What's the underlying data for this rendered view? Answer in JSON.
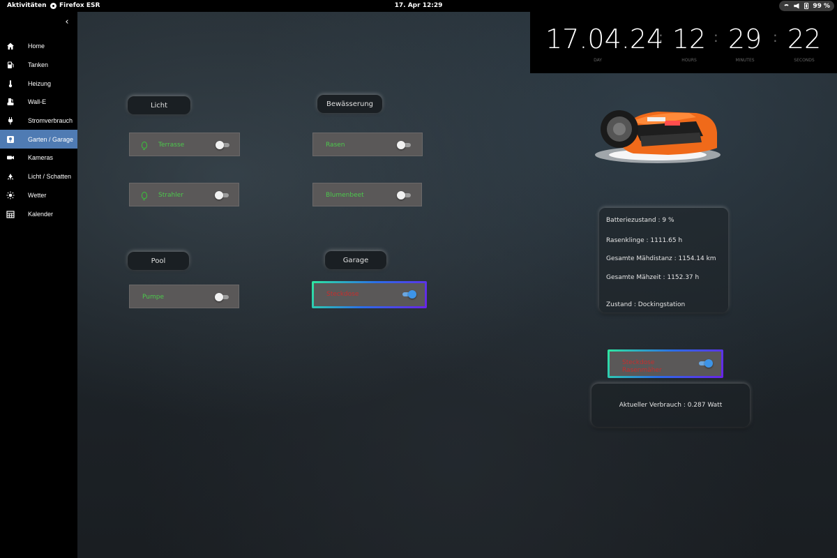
{
  "topbar": {
    "activities": "Aktivitäten",
    "app_name": "Firefox ESR",
    "clock": "17. Apr  12:29",
    "battery": "99 %"
  },
  "sidebar": {
    "items": [
      {
        "label": "Home",
        "icon": "home-icon"
      },
      {
        "label": "Tanken",
        "icon": "fuel-icon"
      },
      {
        "label": "Heizung",
        "icon": "thermometer-icon"
      },
      {
        "label": "Wall-E",
        "icon": "ev-charger-icon"
      },
      {
        "label": "Stromverbrauch",
        "icon": "power-plug-icon"
      },
      {
        "label": "Garten / Garage",
        "icon": "garden-icon",
        "active": true
      },
      {
        "label": "Kameras",
        "icon": "camera-icon"
      },
      {
        "label": "Licht / Schatten",
        "icon": "light-icon"
      },
      {
        "label": "Wetter",
        "icon": "sun-icon"
      },
      {
        "label": "Kalender",
        "icon": "calendar-icon"
      }
    ]
  },
  "clock": {
    "date": "17.04.24",
    "date_label": "DAY",
    "hours": "12",
    "hours_label": "HOURS",
    "minutes": "29",
    "minutes_label": "MINUTES",
    "seconds": "22",
    "seconds_label": "SECONDS"
  },
  "sections": {
    "licht": "Licht",
    "bewaesserung": "Bewässerung",
    "pool": "Pool",
    "garage": "Garage"
  },
  "switches": {
    "terrasse": {
      "label": "Terrasse",
      "on": false
    },
    "strahler": {
      "label": "Strahler",
      "on": false
    },
    "rasen": {
      "label": "Rasen",
      "on": false
    },
    "blumenbeet": {
      "label": "Blumenbeet",
      "on": false
    },
    "pumpe": {
      "label": "Pumpe",
      "on": false
    },
    "steckdose": {
      "label": "Steckdose",
      "on": true
    },
    "steckdose_rasenmaeher": {
      "label_line1": "Steckdose",
      "label_line2": "Rasenmäher",
      "on": true
    }
  },
  "mower": {
    "battery": "Batteriezustand : 9 %",
    "blade": "Rasenklinge : 1111.65 h",
    "distance": "Gesamte Mähdistanz : 1154.14 km",
    "time": "Gesamte Mähzeit : 1152.37 h",
    "state": "Zustand : Dockingstation"
  },
  "power": {
    "current": "Aktueller Verbrauch : 0.287 Watt"
  },
  "colors": {
    "on_label": "#4cc84c",
    "alert_label": "#c62e2e",
    "active_nav": "#4f7bb3",
    "toggle_on": "#3d94e8"
  }
}
